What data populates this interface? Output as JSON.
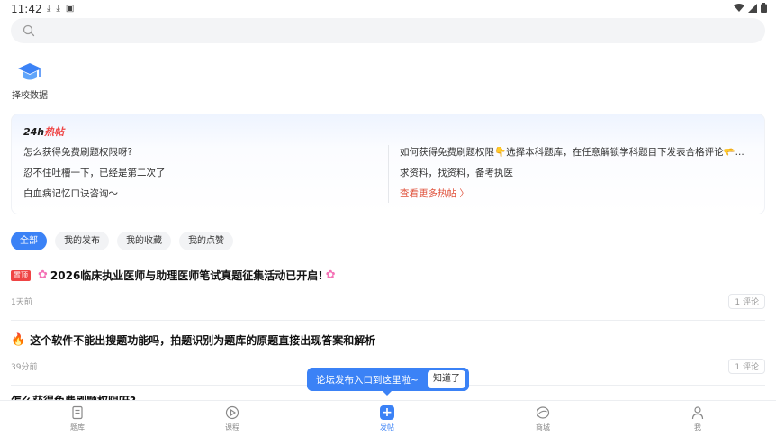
{
  "status_bar": {
    "time": "11:42",
    "left_icons": [
      "download-icon",
      "download-icon",
      "a-icon"
    ],
    "right_icons": [
      "wifi-icon",
      "signal-icon",
      "battery-icon"
    ]
  },
  "search": {
    "placeholder": ""
  },
  "school_entry": {
    "label": "择校数据"
  },
  "hot_posts": {
    "title_prefix": "24h",
    "title_accent": "热帖",
    "left_items": [
      "怎么获得免费刷题权限呀?",
      "忍不住吐槽一下，已经是第二次了",
      "白血病记忆口诀咨询～"
    ],
    "right_items": [
      "如何获得免费刷题权限👇选择本科题库，在任意解锁学科题目下发表合格评论🫳...",
      "求资料，找资料，备考执医"
    ],
    "more_link": "查看更多热帖 〉"
  },
  "filter_tabs": [
    {
      "label": "全部",
      "active": true
    },
    {
      "label": "我的发布",
      "active": false
    },
    {
      "label": "我的收藏",
      "active": false
    },
    {
      "label": "我的点赞",
      "active": false
    }
  ],
  "posts": [
    {
      "badge": "置顶",
      "title": "2026临床执业医师与助理医师笔试真题征集活动已开启!",
      "time": "1天前",
      "comments": "1 评论"
    },
    {
      "title": "这个软件不能出搜题功能吗，拍题识别为题库的原题直接出现答案和解析",
      "time": "39分前",
      "comments": "1 评论"
    }
  ],
  "partial_post": {
    "title": "怎么获得免费刷题权限呀?"
  },
  "tooltip": {
    "text": "论坛发布入口到这里啦~",
    "button": "知道了"
  },
  "bottom_nav": [
    {
      "label": "题库",
      "icon": "question-bank-icon",
      "active": false
    },
    {
      "label": "课程",
      "icon": "play-icon",
      "active": false
    },
    {
      "label": "发帖",
      "icon": "plus-icon",
      "active": true
    },
    {
      "label": "商城",
      "icon": "mall-icon",
      "active": false
    },
    {
      "label": "我",
      "icon": "user-icon",
      "active": false
    }
  ],
  "colors": {
    "accent": "#3b82f6",
    "hot_red": "#ef4444",
    "more_link": "#e0533d"
  }
}
